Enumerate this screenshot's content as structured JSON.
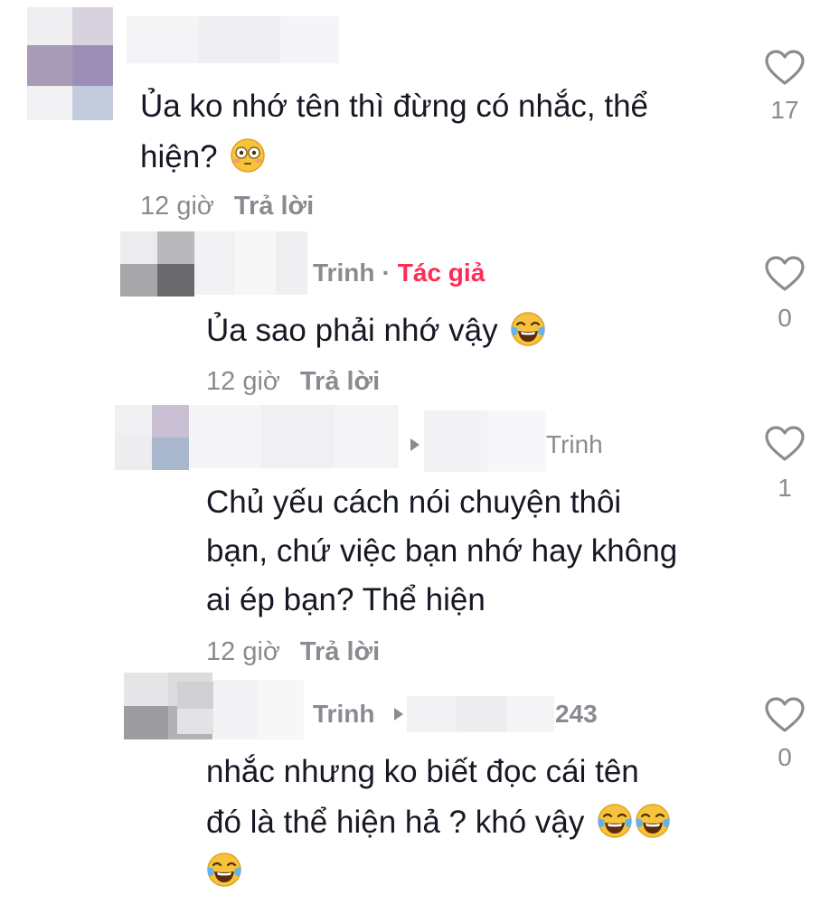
{
  "comments": [
    {
      "username": "",
      "text_lines": [
        "Ủa ko nhớ tên thì đừng có nhắc, thể",
        "hiện?"
      ],
      "emoji": [
        "flushed-face"
      ],
      "time": "12 giờ",
      "reply_label": "Trả lời",
      "likes": "17"
    },
    {
      "username": "Trinh",
      "author_tag": "Tác giả",
      "text_lines": [
        "Ủa sao phải nhớ vậy"
      ],
      "emoji": [
        "tears-of-joy-face"
      ],
      "time": "12 giờ",
      "reply_label": "Trả lời",
      "likes": "0"
    },
    {
      "username": "Trinh",
      "text_lines": [
        "Chủ yếu cách nói chuyện thôi",
        "bạn, chứ việc bạn nhớ hay không",
        "ai ép bạn? Thể hiện"
      ],
      "time": "12 giờ",
      "reply_label": "Trả lời",
      "likes": "1"
    },
    {
      "username": "Trinh",
      "reply_to_suffix": "243",
      "text_lines": [
        "nhắc nhưng ko biết đọc cái tên",
        "đó là thể hiện hả ? khó vậy"
      ],
      "emoji": [
        "tears-of-joy-face",
        "tears-of-joy-face",
        "tears-of-joy-face"
      ],
      "likes": "0"
    }
  ],
  "colors": {
    "text": "#161823",
    "muted": "#8a8b91",
    "author_tag": "#fe2c55"
  }
}
